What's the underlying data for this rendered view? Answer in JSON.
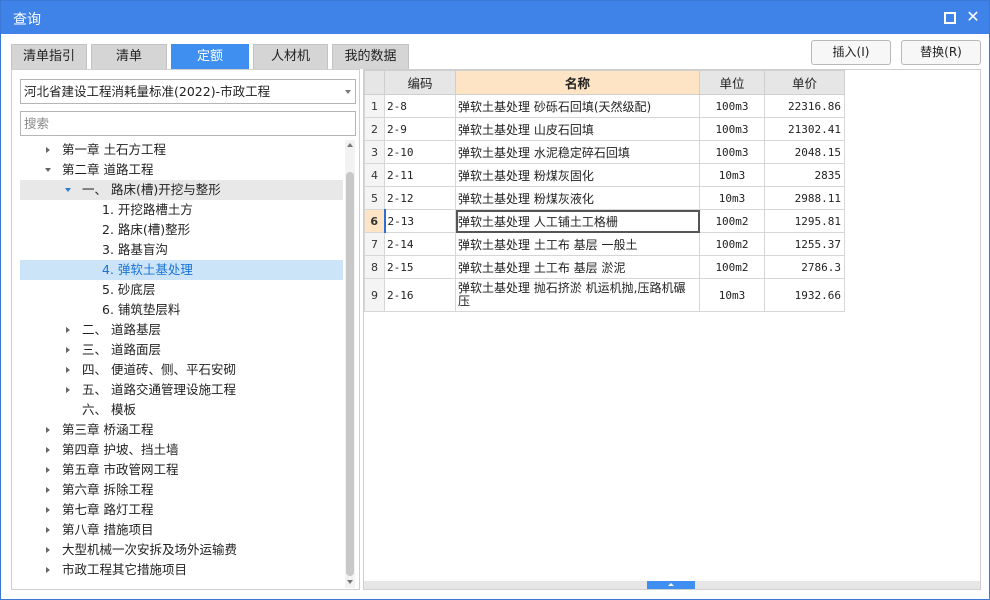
{
  "window": {
    "title": "查询"
  },
  "tabs": [
    {
      "label": "清单指引"
    },
    {
      "label": "清单"
    },
    {
      "label": "定额"
    },
    {
      "label": "人材机"
    },
    {
      "label": "我的数据"
    }
  ],
  "active_tab": "定额",
  "actions": {
    "insert": "插入(I)",
    "replace": "替换(R)"
  },
  "left": {
    "library": "河北省建设工程消耗量标准(2022)-市政工程",
    "search_placeholder": "搜索",
    "tree": [
      {
        "label": "第一章 土石方工程",
        "expander": "collapsed"
      },
      {
        "label": "第二章 道路工程",
        "expander": "expanded"
      },
      {
        "label": "一、 路床(槽)开挖与整形",
        "expander": "expanded",
        "state": "selected-parent"
      },
      {
        "label": "1. 开挖路槽土方",
        "expander": "none"
      },
      {
        "label": "2. 路床(槽)整形",
        "expander": "none"
      },
      {
        "label": "3. 路基盲沟",
        "expander": "none"
      },
      {
        "label": "4. 弹软土基处理",
        "expander": "none",
        "state": "selected"
      },
      {
        "label": "5. 砂底层",
        "expander": "none"
      },
      {
        "label": "6. 铺筑垫层料",
        "expander": "none"
      },
      {
        "label": "二、 道路基层",
        "expander": "collapsed"
      },
      {
        "label": "三、 道路面层",
        "expander": "collapsed"
      },
      {
        "label": "四、 便道砖、侧、平石安砌",
        "expander": "collapsed"
      },
      {
        "label": "五、 道路交通管理设施工程",
        "expander": "collapsed"
      },
      {
        "label": "六、 模板",
        "expander": "none"
      },
      {
        "label": "第三章 桥涵工程",
        "expander": "collapsed"
      },
      {
        "label": "第四章 护坡、挡土墙",
        "expander": "collapsed"
      },
      {
        "label": "第五章 市政管网工程",
        "expander": "collapsed"
      },
      {
        "label": "第六章 拆除工程",
        "expander": "collapsed"
      },
      {
        "label": "第七章 路灯工程",
        "expander": "collapsed"
      },
      {
        "label": "第八章 措施项目",
        "expander": "collapsed"
      },
      {
        "label": "大型机械一次安拆及场外运输费",
        "expander": "collapsed"
      },
      {
        "label": "市政工程其它措施项目",
        "expander": "collapsed"
      }
    ]
  },
  "grid": {
    "headers": {
      "code": "编码",
      "name": "名称",
      "unit": "单位",
      "price": "单价"
    },
    "rows": [
      {
        "idx": "1",
        "code": "2-8",
        "name": "弹软土基处理 砂砾石回填(天然级配)",
        "unit": "100m3",
        "price": "22316.86"
      },
      {
        "idx": "2",
        "code": "2-9",
        "name": "弹软土基处理 山皮石回填",
        "unit": "100m3",
        "price": "21302.41"
      },
      {
        "idx": "3",
        "code": "2-10",
        "name": "弹软土基处理 水泥稳定碎石回填",
        "unit": "100m3",
        "price": "2048.15"
      },
      {
        "idx": "4",
        "code": "2-11",
        "name": "弹软土基处理 粉煤灰固化",
        "unit": "10m3",
        "price": "2835"
      },
      {
        "idx": "5",
        "code": "2-12",
        "name": "弹软土基处理 粉煤灰液化",
        "unit": "10m3",
        "price": "2988.11"
      },
      {
        "idx": "6",
        "code": "2-13",
        "name": "弹软土基处理 人工铺土工格栅",
        "unit": "100m2",
        "price": "1295.81"
      },
      {
        "idx": "7",
        "code": "2-14",
        "name": "弹软土基处理 土工布 基层 一般土",
        "unit": "100m2",
        "price": "1255.37"
      },
      {
        "idx": "8",
        "code": "2-15",
        "name": "弹软土基处理 土工布 基层 淤泥",
        "unit": "100m2",
        "price": "2786.3"
      },
      {
        "idx": "9",
        "code": "2-16",
        "name": "弹软土基处理 抛石挤淤 机运机抛,压路机碾压",
        "unit": "10m3",
        "price": "1932.66"
      }
    ],
    "current_row": "6"
  },
  "icons": {
    "restore": "restore-icon",
    "close": "close-icon",
    "dropdown": "chevron-down-icon"
  }
}
